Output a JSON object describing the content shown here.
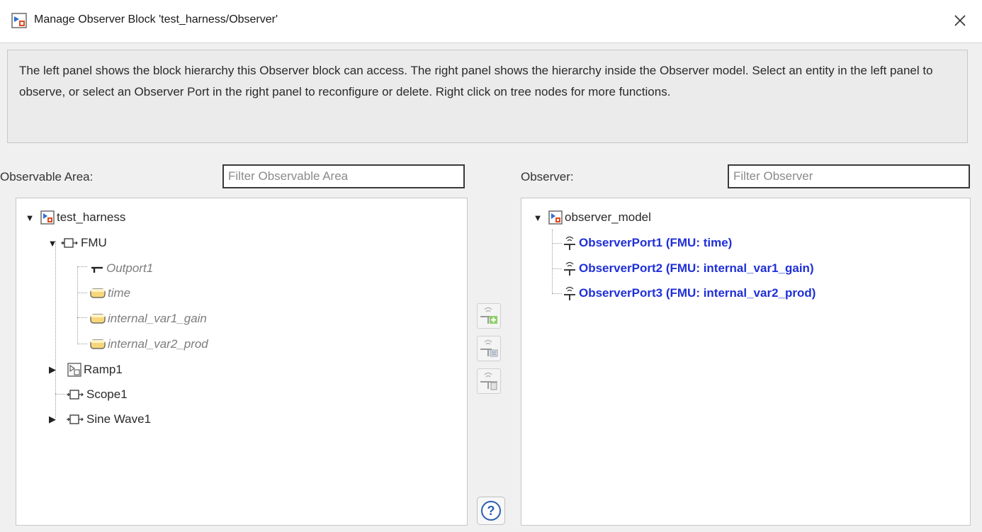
{
  "window": {
    "title": "Manage Observer Block 'test_harness/Observer'",
    "close_icon": "close-icon"
  },
  "description": "The left panel shows the block hierarchy this Observer block can access. The right panel shows the hierarchy inside the Observer model. Select an entity in the left panel to observe, or select an Observer Port in the right panel to reconfigure or delete. Right click on tree nodes for more functions.",
  "left": {
    "label": "Observable Area:",
    "filter_placeholder": "Filter Observable Area",
    "tree": [
      {
        "label": "test_harness",
        "icon": "model-icon",
        "expanded": true
      },
      {
        "label": "FMU",
        "icon": "fmu-block-icon",
        "expanded": true
      },
      {
        "label": "Outport1",
        "icon": "outport-icon"
      },
      {
        "label": "time",
        "icon": "variable-icon"
      },
      {
        "label": "internal_var1_gain",
        "icon": "variable-icon"
      },
      {
        "label": "internal_var2_prod",
        "icon": "variable-icon"
      },
      {
        "label": "Ramp1",
        "icon": "subsystem-icon",
        "expanded": false
      },
      {
        "label": "Scope1",
        "icon": "block-icon"
      },
      {
        "label": "Sine Wave1",
        "icon": "block-icon",
        "expanded": false
      }
    ]
  },
  "right": {
    "label": "Observer:",
    "filter_placeholder": "Filter Observer",
    "tree": [
      {
        "label": "observer_model",
        "icon": "model-icon",
        "expanded": true
      },
      {
        "label": "ObserverPort1 (FMU: time)",
        "icon": "observer-port-icon"
      },
      {
        "label": "ObserverPort2 (FMU: internal_var1_gain)",
        "icon": "observer-port-icon"
      },
      {
        "label": "ObserverPort3 (FMU: internal_var2_prod)",
        "icon": "observer-port-icon"
      }
    ]
  },
  "middle_buttons": [
    "add-observer-port-icon",
    "reconfigure-observer-port-icon",
    "delete-observer-port-icon"
  ],
  "help_label": "?",
  "colors": {
    "port_link": "#1f2fd8",
    "disabled_item": "#7d7d7d",
    "variable_fill": "#f8d67a"
  }
}
